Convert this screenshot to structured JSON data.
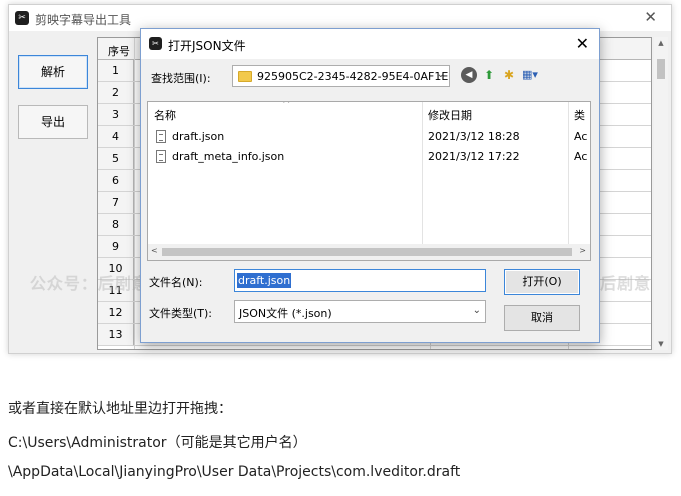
{
  "app": {
    "title": "剪映字幕导出工具",
    "logo_glyph": "✂",
    "close_glyph": "✕",
    "buttons": {
      "parse": "解析",
      "export": "导出"
    },
    "grid": {
      "header": "序号",
      "rows": [
        "1",
        "2",
        "3",
        "4",
        "5",
        "6",
        "7",
        "8",
        "9",
        "10",
        "11",
        "12",
        "13"
      ]
    }
  },
  "dialog": {
    "title": "打开JSON文件",
    "close_glyph": "✕",
    "look_in_label": "查找范围(I):",
    "look_in_value": "925905C2-2345-4282-95E4-0AF1E",
    "toolbar_icons": [
      "back-icon",
      "up-folder-icon",
      "new-folder-icon",
      "view-menu-icon"
    ],
    "columns": {
      "name": "名称",
      "modified": "修改日期",
      "type": "类"
    },
    "files": [
      {
        "name": "draft.json",
        "date": "2021/3/12 18:28",
        "type": "Ac"
      },
      {
        "name": "draft_meta_info.json",
        "date": "2021/3/12 17:22",
        "type": "Ac"
      }
    ],
    "filename_label": "文件名(N):",
    "filename_value": "draft.json",
    "filetype_label": "文件类型(T):",
    "filetype_value": "JSON文件 (*.json)",
    "open_button": "打开(O)",
    "cancel_button": "取消"
  },
  "watermark": "公众号：后剧意 公众号：后剧意 公众号：后剧意 公众号：后剧意 公众号：后剧意",
  "article": {
    "lines": [
      "或者直接在默认地址里边打开拖拽：",
      "C:\\Users\\Administrator（可能是其它用户名）",
      "\\AppData\\Local\\JianyingPro\\User Data\\Projects\\com.lveditor.draft"
    ]
  },
  "colors": {
    "accent": "#3c86d9",
    "selection": "#2f6fd0",
    "folder": "#f2c94c"
  }
}
